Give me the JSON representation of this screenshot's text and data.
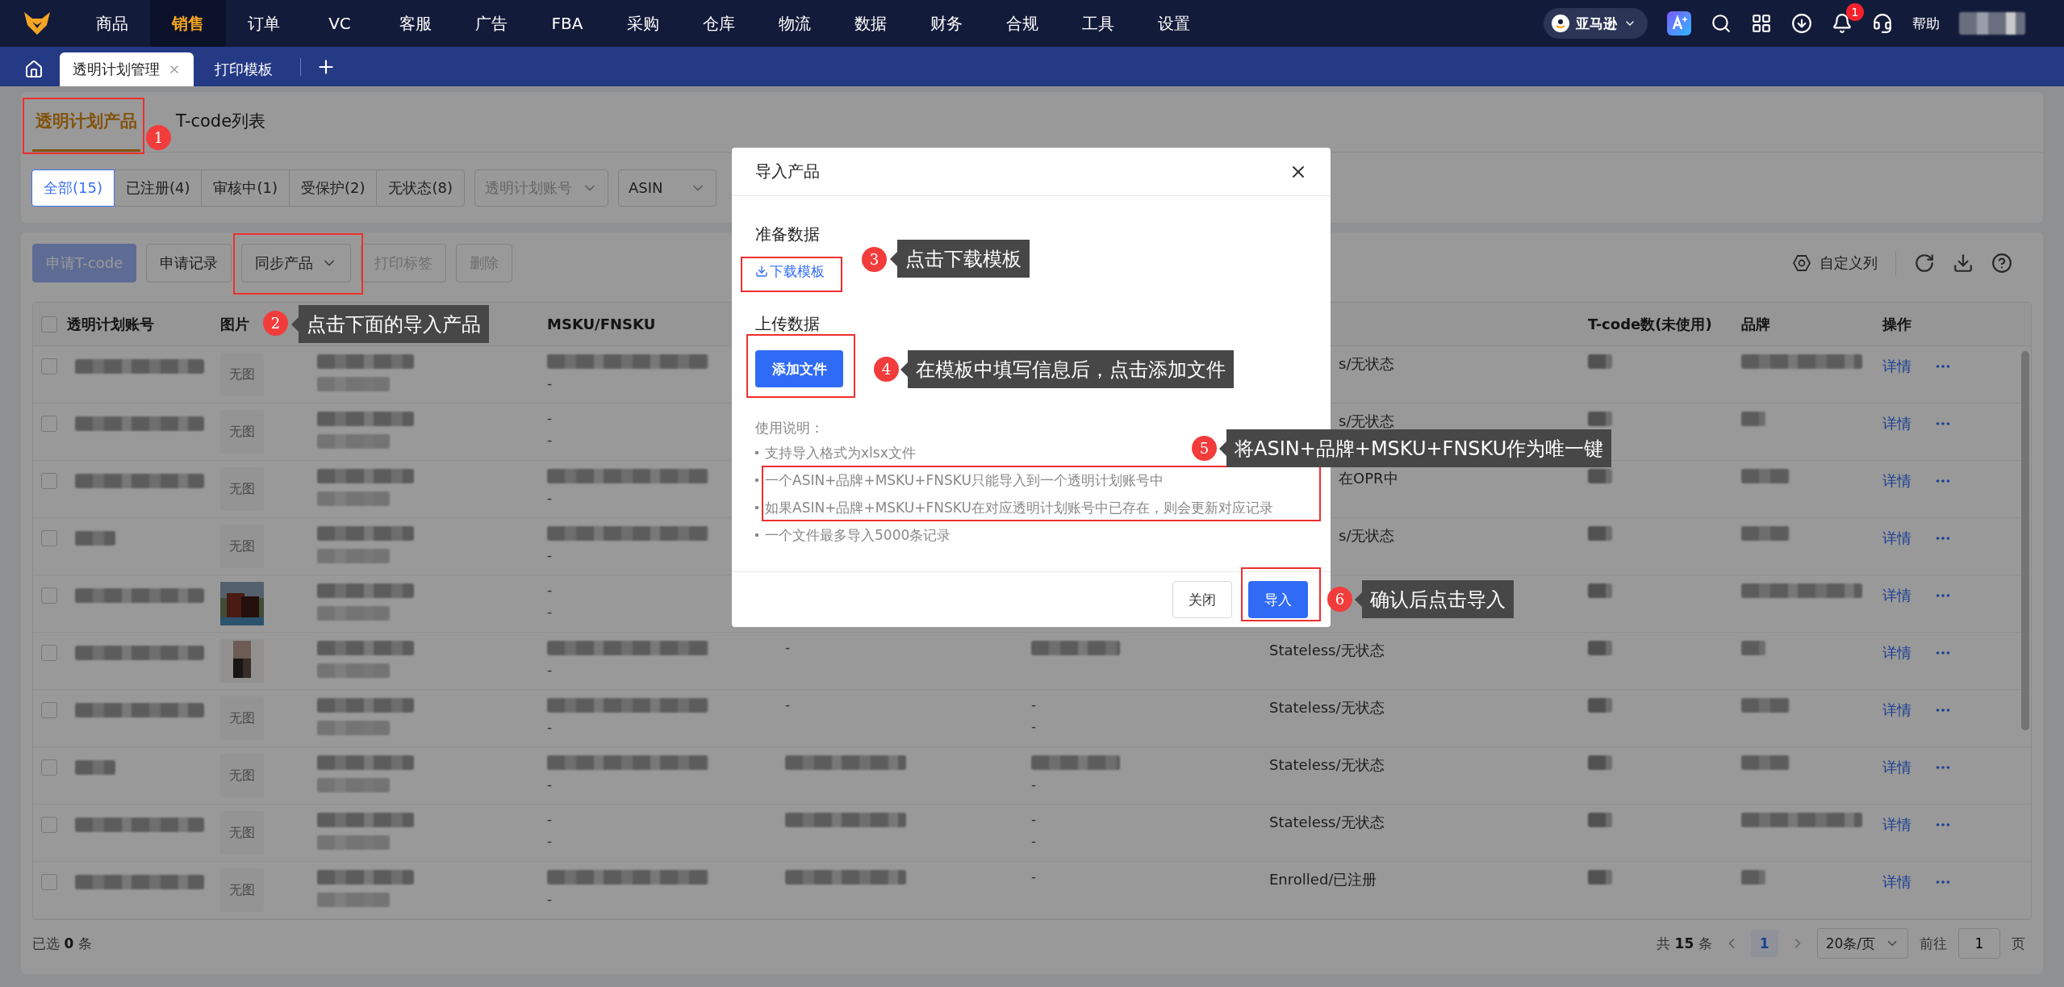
{
  "nav": {
    "items": [
      {
        "label": "商品",
        "selected": false
      },
      {
        "label": "销售",
        "selected": true
      },
      {
        "label": "订单",
        "selected": false
      },
      {
        "label": "VC",
        "selected": false
      },
      {
        "label": "客服",
        "selected": false
      },
      {
        "label": "广告",
        "selected": false
      },
      {
        "label": "FBA",
        "selected": false
      },
      {
        "label": "采购",
        "selected": false
      },
      {
        "label": "仓库",
        "selected": false
      },
      {
        "label": "物流",
        "selected": false
      },
      {
        "label": "数据",
        "selected": false
      },
      {
        "label": "财务",
        "selected": false
      },
      {
        "label": "合规",
        "selected": false
      },
      {
        "label": "工具",
        "selected": false
      },
      {
        "label": "设置",
        "selected": false
      }
    ],
    "store": "亚马逊",
    "notification_count": "1",
    "help": "帮助"
  },
  "tabs": [
    {
      "label": "透明计划管理",
      "selected": true
    },
    {
      "label": "打印模板",
      "selected": false
    }
  ],
  "page_tabs": [
    {
      "label": "透明计划产品",
      "selected": true
    },
    {
      "label": "T-code列表",
      "selected": false
    }
  ],
  "filters": {
    "status": [
      {
        "label": "全部(15)",
        "selected": true
      },
      {
        "label": "已注册(4)",
        "selected": false
      },
      {
        "label": "审核中(1)",
        "selected": false
      },
      {
        "label": "受保护(2)",
        "selected": false
      },
      {
        "label": "无状态(8)",
        "selected": false
      }
    ],
    "account_select": {
      "placeholder": "透明计划账号"
    },
    "type_select": {
      "value": "ASIN"
    }
  },
  "toolbar": {
    "buttons": [
      {
        "label": "申请T-code",
        "kind": "primary",
        "disabled": true
      },
      {
        "label": "申请记录",
        "kind": "default",
        "disabled": false
      },
      {
        "label": "同步产品",
        "kind": "dropdown",
        "disabled": false
      },
      {
        "label": "打印标签",
        "kind": "default",
        "disabled": true
      },
      {
        "label": "删除",
        "kind": "default",
        "disabled": true
      }
    ],
    "custom_columns": "自定义列"
  },
  "table": {
    "columns": {
      "account": "透明计划账号",
      "image": "图片",
      "msku": "MSKU/FNSKU",
      "tcode": "T-code数(未使用)",
      "brand": "品牌",
      "actions": "操作"
    },
    "all_checked": false,
    "rows": [
      {
        "checked": false,
        "image": {
          "kind": "placeholder",
          "text": "无图"
        },
        "msku": [
          {
            "kind": "blur"
          },
          {
            "kind": "text",
            "text": "-"
          }
        ],
        "status": {
          "kind": "partial",
          "text": "s/无状态"
        },
        "detail": "详情"
      },
      {
        "checked": false,
        "image": {
          "kind": "placeholder",
          "text": "无图"
        },
        "msku": [
          {
            "kind": "text",
            "text": "-"
          },
          {
            "kind": "text",
            "text": "-"
          }
        ],
        "status": {
          "kind": "partial",
          "text": "s/无状态"
        },
        "detail": "详情"
      },
      {
        "checked": false,
        "image": {
          "kind": "placeholder",
          "text": "无图"
        },
        "msku": [
          {
            "kind": "blur"
          },
          {
            "kind": "text",
            "text": "-"
          }
        ],
        "status": {
          "kind": "partial",
          "text": "在OPR中"
        },
        "detail": "详情"
      },
      {
        "checked": false,
        "image": {
          "kind": "placeholder",
          "text": "无图"
        },
        "msku": [
          {
            "kind": "blur"
          },
          {
            "kind": "text",
            "text": "-"
          }
        ],
        "status": {
          "kind": "partial",
          "text": "s/无状态"
        },
        "detail": "详情"
      },
      {
        "checked": false,
        "image": {
          "kind": "picture"
        },
        "msku": [
          {
            "kind": "text",
            "text": "-"
          },
          {
            "kind": "text",
            "text": "-"
          }
        ],
        "detail": "详情"
      },
      {
        "checked": false,
        "image": {
          "kind": "picture"
        },
        "msku": [
          {
            "kind": "blur"
          },
          {
            "kind": "text",
            "text": "-"
          }
        ],
        "column_5": [
          {
            "kind": "text",
            "text": "-"
          }
        ],
        "column_6": [
          {
            "kind": "blur"
          }
        ],
        "status": {
          "kind": "full",
          "text": "Stateless/无状态"
        },
        "detail": "详情"
      },
      {
        "checked": false,
        "image": {
          "kind": "placeholder",
          "text": "无图"
        },
        "msku": [
          {
            "kind": "blur"
          },
          {
            "kind": "text",
            "text": "-"
          }
        ],
        "column_5": [
          {
            "kind": "text",
            "text": "-"
          }
        ],
        "column_6": [
          {
            "kind": "text",
            "text": "-"
          },
          {
            "kind": "text",
            "text": "-"
          }
        ],
        "status": {
          "kind": "full",
          "text": "Stateless/无状态"
        },
        "detail": "详情"
      },
      {
        "checked": false,
        "image": {
          "kind": "placeholder",
          "text": "无图"
        },
        "msku": [
          {
            "kind": "blur"
          },
          {
            "kind": "text",
            "text": "-"
          }
        ],
        "column_5": [
          {
            "kind": "blur"
          }
        ],
        "column_6": [
          {
            "kind": "blur"
          },
          {
            "kind": "text",
            "text": "-"
          }
        ],
        "status": {
          "kind": "full",
          "text": "Stateless/无状态"
        },
        "detail": "详情"
      },
      {
        "checked": false,
        "image": {
          "kind": "placeholder",
          "text": "无图"
        },
        "msku": [
          {
            "kind": "text",
            "text": "-"
          },
          {
            "kind": "text",
            "text": "-"
          }
        ],
        "column_5": [
          {
            "kind": "blur"
          }
        ],
        "column_6": [
          {
            "kind": "text",
            "text": "-"
          },
          {
            "kind": "text",
            "text": "-"
          }
        ],
        "status": {
          "kind": "full",
          "text": "Stateless/无状态"
        },
        "detail": "详情"
      },
      {
        "checked": false,
        "image": {
          "kind": "placeholder",
          "text": "无图"
        },
        "msku": [
          {
            "kind": "blur"
          },
          {
            "kind": "text",
            "text": "-"
          }
        ],
        "column_5": [
          {
            "kind": "blur"
          }
        ],
        "column_6": [
          {
            "kind": "text",
            "text": "-"
          }
        ],
        "status": {
          "kind": "full",
          "text": "Enrolled/已注册"
        },
        "detail": "详情"
      }
    ]
  },
  "footer": {
    "selected_prefix": "已选",
    "selected_count": "0",
    "selected_suffix": "条",
    "total_prefix": "共",
    "total": "15",
    "total_suffix": "条",
    "pages": [
      {
        "label": "1",
        "selected": true
      }
    ],
    "page_size": "20条/页",
    "goto_prefix": "前往",
    "goto_value": "1",
    "goto_suffix": "页"
  },
  "modal": {
    "title": "导入产品",
    "prepare_heading": "准备数据",
    "download_link": "下载模板",
    "upload_heading": "上传数据",
    "add_file": "添加文件",
    "instructions_title": "使用说明：",
    "instructions": [
      "支持导入格式为xlsx文件",
      "一个ASIN+品牌+MSKU+FNSKU只能导入到一个透明计划账号中",
      "如果ASIN+品牌+MSKU+FNSKU在对应透明计划账号中已存在，则会更新对应记录",
      "一个文件最多导入5000条记录"
    ],
    "buttons": [
      {
        "label": "关闭",
        "kind": "default"
      },
      {
        "label": "导入",
        "kind": "primary"
      }
    ]
  },
  "annotations": [
    {
      "number": "1"
    },
    {
      "number": "2",
      "text": "点击下面的导入产品"
    },
    {
      "number": "3",
      "text": "点击下载模板"
    },
    {
      "number": "4",
      "text": "在模板中填写信息后，点击添加文件"
    },
    {
      "number": "5",
      "text": "将ASIN+品牌+MSKU+FNSKU作为唯一键"
    },
    {
      "number": "6",
      "text": "确认后点击导入"
    }
  ]
}
